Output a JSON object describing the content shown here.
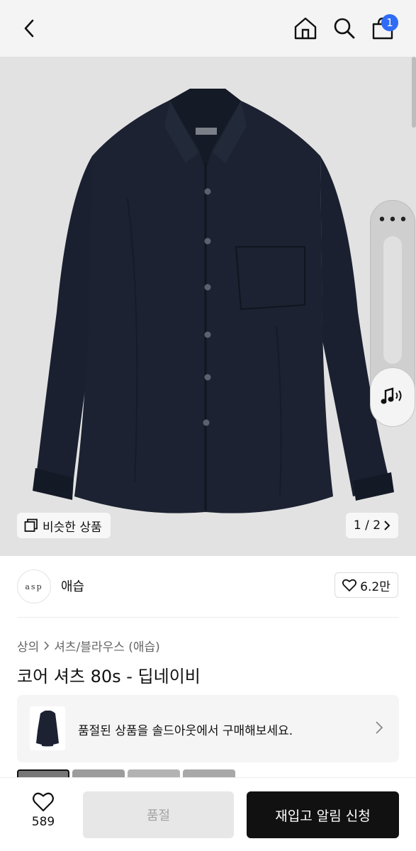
{
  "header": {
    "cart_count": "1"
  },
  "gallery": {
    "similar_label": "비슷한 상품",
    "page_indicator": "1 / 2"
  },
  "brand": {
    "logo_text": "asp",
    "name": "애습",
    "likes": "6.2만"
  },
  "product": {
    "breadcrumb": [
      "상의",
      "셔츠/블라우스 (애습)"
    ],
    "title": "코어 셔츠 80s - 딥네이비"
  },
  "soldout_notice": {
    "text": "품절된 상품을 솔드아웃에서 구매해보세요."
  },
  "bottom_bar": {
    "wish_count": "589",
    "soldout_label": "품절",
    "restock_label": "재입고 알림 신청"
  },
  "colors": {
    "accent": "#2f6bf5",
    "shirt": "#1c2231",
    "cta": "#111111"
  },
  "icons": [
    "back-icon",
    "home-icon",
    "search-icon",
    "cart-icon",
    "more-icon",
    "sound-icon",
    "similar-icon",
    "chevron-right-icon",
    "heart-icon"
  ]
}
